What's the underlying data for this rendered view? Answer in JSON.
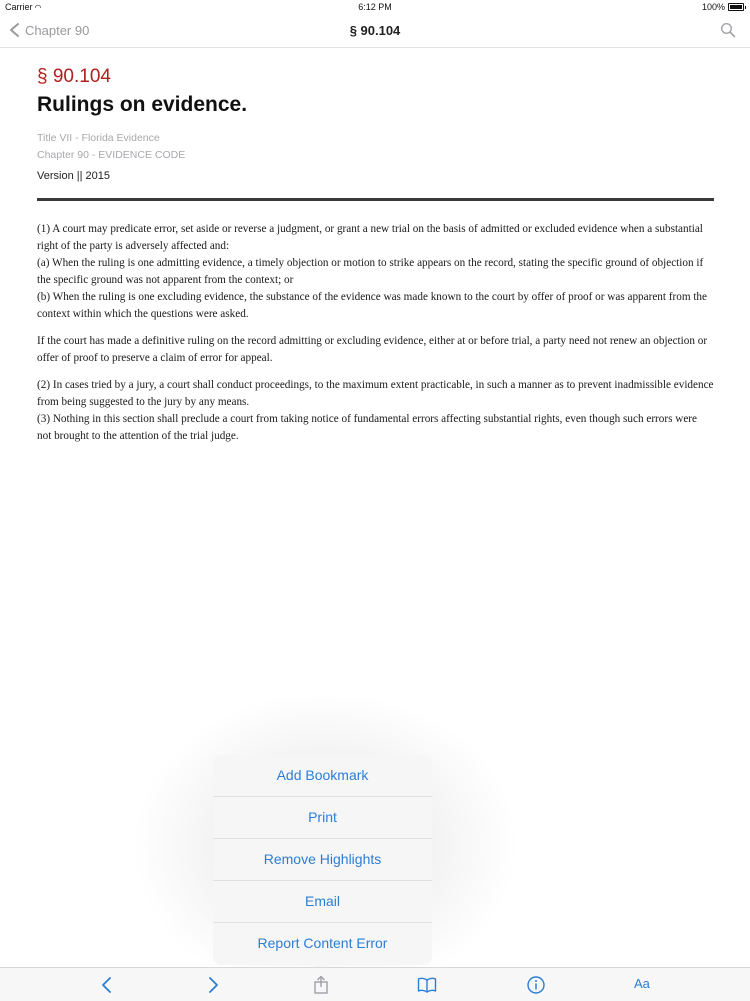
{
  "status_bar": {
    "carrier": "Carrier",
    "time": "6:12 PM",
    "battery": "100%"
  },
  "nav": {
    "back_label": "Chapter 90",
    "title": "§ 90.104"
  },
  "document": {
    "section_number": "§ 90.104",
    "title": "Rulings on evidence.",
    "title_line": "Title VII - Florida Evidence",
    "chapter_line": "Chapter 90 - EVIDENCE CODE",
    "version": "Version || 2015",
    "paragraphs": [
      "(1)   A court may predicate error, set aside or reverse a judgment, or grant a new trial on the basis of admitted or excluded evidence when a substantial right of the party is adversely affected and:",
      "(a)   When the ruling is one admitting evidence, a timely objection or motion to strike appears on the record, stating the specific ground of objection if the specific ground was not apparent from the context; or",
      "(b)   When the ruling is one excluding evidence, the substance of the evidence was made known to the court by offer of proof or was apparent from the context within which the questions were asked.",
      "If the court has made a definitive ruling on the record admitting or excluding evidence, either at or before trial, a party need not renew an objection or offer of proof to preserve a claim of error for appeal.",
      "(2)   In cases tried by a jury, a court shall conduct proceedings, to the maximum extent practicable, in such a manner as to prevent inadmissible evidence from being suggested to the jury by any means.",
      "(3)   Nothing in this section shall preclude a court from taking notice of fundamental errors affecting substantial rights, even though such errors were not brought to the attention of the trial judge."
    ]
  },
  "popover_menu": {
    "items": [
      "Add Bookmark",
      "Print",
      "Remove Highlights",
      "Email",
      "Report Content Error"
    ]
  },
  "toolbar": {
    "font_size_label": "Aa",
    "icons": [
      "chevron-left-icon",
      "chevron-right-icon",
      "share-icon",
      "book-icon",
      "info-icon"
    ]
  },
  "colors": {
    "accent": "#2b7ed6",
    "section_red": "#b0201e",
    "muted_gray": "#a8a8ad"
  }
}
